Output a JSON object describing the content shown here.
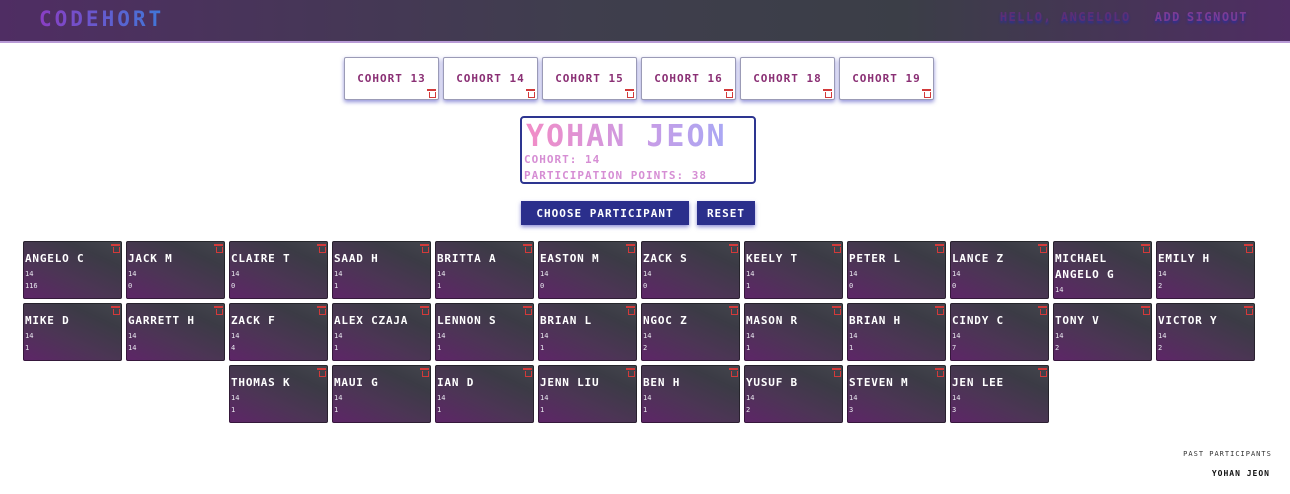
{
  "header": {
    "logo": "CODEHORT",
    "greeting": "HELLO, ANGELOLO",
    "add_label": "ADD",
    "signout_label": "SIGNOUT"
  },
  "cohort_tabs": [
    {
      "label": "COHORT 13"
    },
    {
      "label": "COHORT 14"
    },
    {
      "label": "COHORT 15"
    },
    {
      "label": "COHORT 16"
    },
    {
      "label": "COHORT 18"
    },
    {
      "label": "COHORT 19"
    }
  ],
  "selected": {
    "name": "YOHAN JEON",
    "cohort_line": "COHORT: 14",
    "points_line": "PARTICIPATION POINTS: 38"
  },
  "actions": {
    "choose_label": "CHOOSE PARTICIPANT",
    "reset_label": "RESET"
  },
  "participants": [
    {
      "name": "ANGELO C",
      "cohort": "14",
      "points": "116"
    },
    {
      "name": "JACK M",
      "cohort": "14",
      "points": "0"
    },
    {
      "name": "CLAIRE T",
      "cohort": "14",
      "points": "0"
    },
    {
      "name": "SAAD H",
      "cohort": "14",
      "points": "1"
    },
    {
      "name": "BRITTA A",
      "cohort": "14",
      "points": "1"
    },
    {
      "name": "EASTON M",
      "cohort": "14",
      "points": "0"
    },
    {
      "name": "ZACK S",
      "cohort": "14",
      "points": "0"
    },
    {
      "name": "KEELY T",
      "cohort": "14",
      "points": "1"
    },
    {
      "name": "PETER L",
      "cohort": "14",
      "points": "0"
    },
    {
      "name": "LANCE Z",
      "cohort": "14",
      "points": "0"
    },
    {
      "name": "MICHAEL ANGELO G",
      "cohort": "14",
      "points": ""
    },
    {
      "name": "EMILY H",
      "cohort": "14",
      "points": "2"
    },
    {
      "name": "MIKE D",
      "cohort": "14",
      "points": "1"
    },
    {
      "name": "GARRETT H",
      "cohort": "14",
      "points": "14"
    },
    {
      "name": "ZACK F",
      "cohort": "14",
      "points": "4"
    },
    {
      "name": "ALEX CZAJA",
      "cohort": "14",
      "points": "1"
    },
    {
      "name": "LENNON S",
      "cohort": "14",
      "points": "1"
    },
    {
      "name": "BRIAN L",
      "cohort": "14",
      "points": "1"
    },
    {
      "name": "NGOC Z",
      "cohort": "14",
      "points": "2"
    },
    {
      "name": "MASON R",
      "cohort": "14",
      "points": "1"
    },
    {
      "name": "BRIAN H",
      "cohort": "14",
      "points": "1"
    },
    {
      "name": "CINDY C",
      "cohort": "14",
      "points": "7"
    },
    {
      "name": "TONY V",
      "cohort": "14",
      "points": "2"
    },
    {
      "name": "VICTOR Y",
      "cohort": "14",
      "points": "2"
    },
    {
      "name": "THOMAS K",
      "cohort": "14",
      "points": "1"
    },
    {
      "name": "MAUI G",
      "cohort": "14",
      "points": "1"
    },
    {
      "name": "IAN D",
      "cohort": "14",
      "points": "1"
    },
    {
      "name": "JENN LIU",
      "cohort": "14",
      "points": "1"
    },
    {
      "name": "BEN H",
      "cohort": "14",
      "points": "1"
    },
    {
      "name": "YUSUF B",
      "cohort": "14",
      "points": "2"
    },
    {
      "name": "STEVEN M",
      "cohort": "14",
      "points": "3"
    },
    {
      "name": "JEN LEE",
      "cohort": "14",
      "points": "3"
    }
  ],
  "past": {
    "title": "PAST PARTICIPANTS",
    "items": [
      "YOHAN JEON"
    ]
  }
}
